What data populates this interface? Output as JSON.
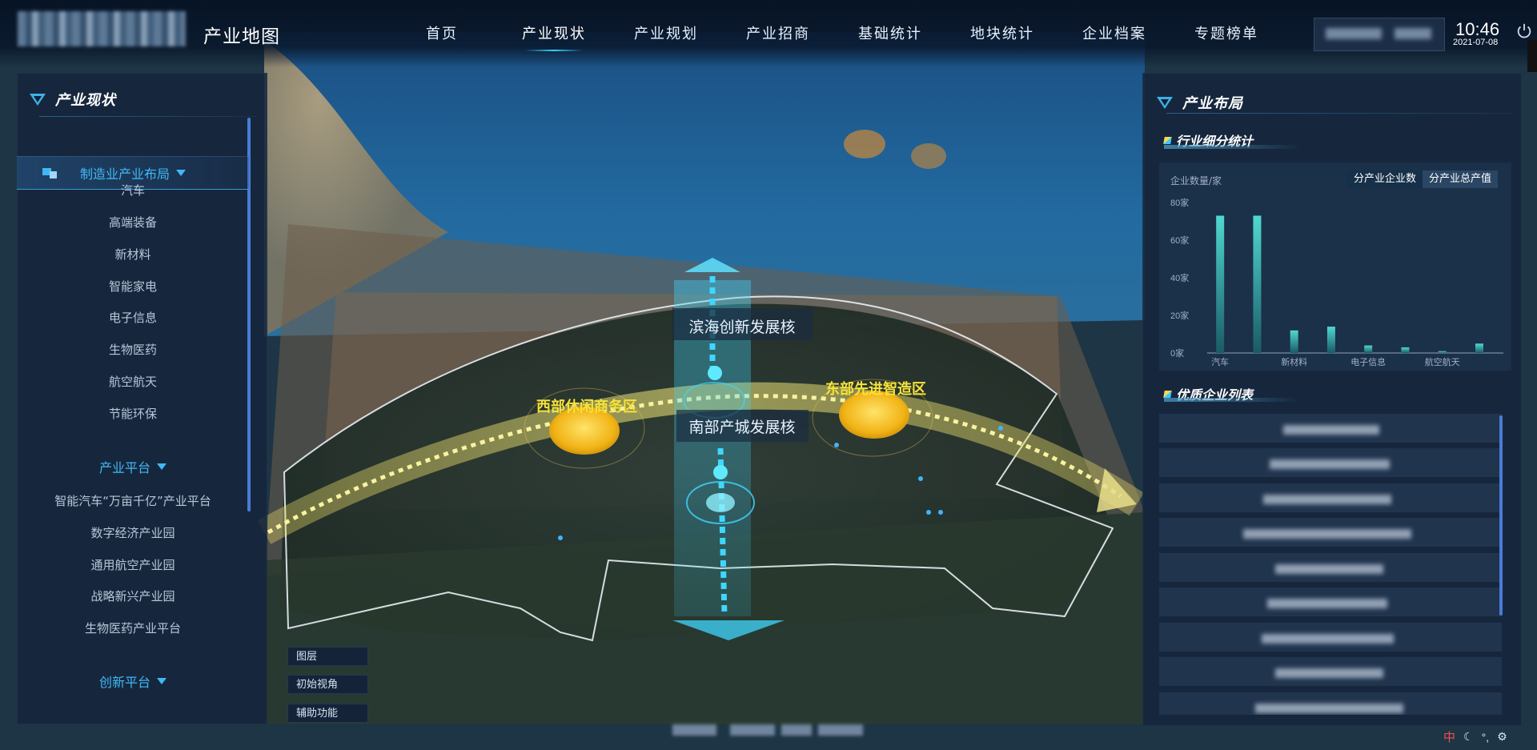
{
  "app": {
    "title": "产业地图"
  },
  "nav": {
    "items": [
      {
        "label": "首页",
        "active": false
      },
      {
        "label": "产业现状",
        "active": true
      },
      {
        "label": "产业规划",
        "active": false
      },
      {
        "label": "产业招商",
        "active": false
      },
      {
        "label": "基础统计",
        "active": false
      },
      {
        "label": "地块统计",
        "active": false
      },
      {
        "label": "企业档案",
        "active": false
      },
      {
        "label": "专题榜单",
        "active": false
      }
    ]
  },
  "clock": {
    "time": "10:46",
    "date": "2021-07-08"
  },
  "left_panel": {
    "title": "产业现状",
    "categories": [
      {
        "label": "制造业产业布局",
        "items": [
          "汽车",
          "高端装备",
          "新材料",
          "智能家电",
          "电子信息",
          "生物医药",
          "航空航天",
          "节能环保"
        ]
      },
      {
        "label": "产业平台",
        "items": [
          "智能汽车“万亩千亿”产业平台",
          "数字经济产业园",
          "通用航空产业园",
          "战略新兴产业园",
          "生物医药产业平台"
        ]
      },
      {
        "label": "创新平台",
        "items": []
      }
    ]
  },
  "map": {
    "labels": {
      "north_core": "滨海创新发展核",
      "south_core": "南部产城发展核",
      "west_zone": "西部休闲商务区",
      "east_zone": "东部先进智造区"
    },
    "tools": [
      "图层",
      "初始视角",
      "辅助功能"
    ]
  },
  "right_panel": {
    "title": "产业布局",
    "stats_title": "行业细分统计",
    "list_title": "优质企业列表",
    "toggles": [
      {
        "label": "分产业企业数",
        "active": true
      },
      {
        "label": "分产业总产值",
        "active": false
      }
    ]
  },
  "chart_data": {
    "type": "bar",
    "ylabel": "企业数量/家",
    "ylim": [
      0,
      80
    ],
    "yticks": [
      "80家",
      "60家",
      "40家",
      "20家",
      "0家"
    ],
    "categories": [
      "汽车",
      "高端装备",
      "新材料",
      "智能家电",
      "电子信息",
      "生物医药",
      "航空航天",
      "节能环保"
    ],
    "x_tick_labels": [
      "汽车",
      "",
      "新材料",
      "",
      "电子信息",
      "",
      "航空航天",
      ""
    ],
    "values": [
      73,
      73,
      12,
      14,
      4,
      3,
      1,
      5
    ],
    "colors": [
      "#4fd9d0",
      "#1a5a66"
    ]
  },
  "status": {
    "ime": "中"
  },
  "colors": {
    "accent": "#41b8f5",
    "zone_label": "#f5e23a",
    "panel_bg": "#16263c"
  }
}
